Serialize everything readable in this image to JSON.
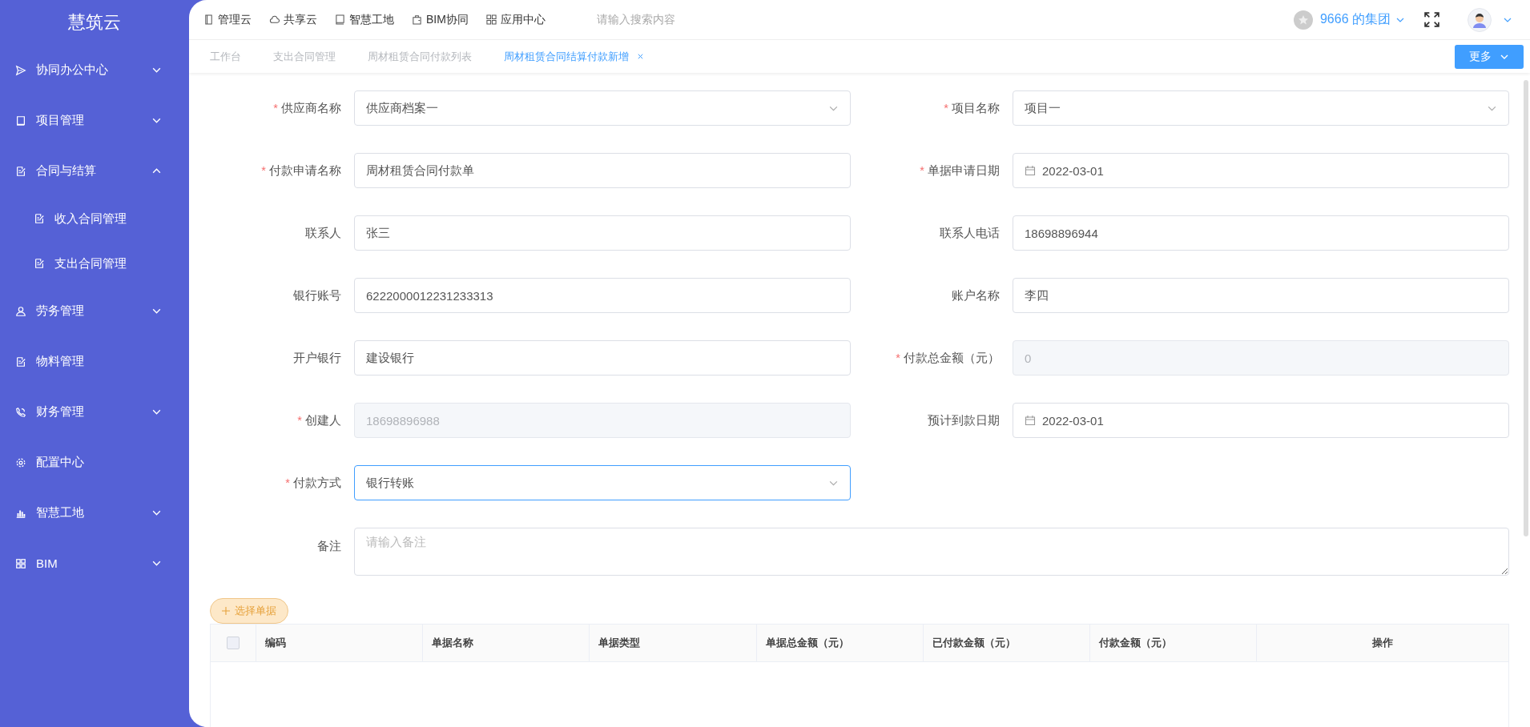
{
  "sidebar": {
    "title": "慧筑云",
    "items": [
      {
        "label": "协同办公中心",
        "expanded": false
      },
      {
        "label": "项目管理",
        "expanded": false
      },
      {
        "label": "合同与结算",
        "expanded": true,
        "children": [
          {
            "label": "收入合同管理"
          },
          {
            "label": "支出合同管理"
          }
        ]
      },
      {
        "label": "劳务管理",
        "expanded": false
      },
      {
        "label": "物料管理"
      },
      {
        "label": "财务管理",
        "expanded": false
      },
      {
        "label": "配置中心"
      },
      {
        "label": "智慧工地",
        "expanded": false
      },
      {
        "label": "BIM",
        "expanded": false
      }
    ]
  },
  "top_nav": {
    "links": [
      "管理云",
      "共享云",
      "智慧工地",
      "BIM协同",
      "应用中心"
    ],
    "search": {
      "placeholder": "请输入搜索内容"
    },
    "organization": "9666 的集团"
  },
  "tabs": [
    {
      "label": "工作台",
      "selected": false
    },
    {
      "label": "支出合同管理",
      "selected": false
    },
    {
      "label": "周材租赁合同付款列表",
      "selected": false
    },
    {
      "label": "周材租赁合同结算付款新增",
      "selected": true
    }
  ],
  "more_button": "更多",
  "form": {
    "fields": [
      {
        "label": "供应商名称",
        "required_mark": "*",
        "kind": "select",
        "value": "供应商档案一"
      },
      {
        "label": "项目名称",
        "required_mark": "*",
        "kind": "select",
        "value": "项目一"
      },
      {
        "label": "付款申请名称",
        "required_mark": "*",
        "kind": "input",
        "value": "周材租赁合同付款单"
      },
      {
        "label": "单据申请日期",
        "required_mark": "*",
        "kind": "date",
        "value": "2022-03-01"
      },
      {
        "label": "联系人",
        "kind": "input",
        "value": "张三"
      },
      {
        "label": "联系人电话",
        "kind": "input",
        "value": "18698896944"
      },
      {
        "label": "银行账号",
        "kind": "input",
        "value": "6222000012231233313"
      },
      {
        "label": "账户名称",
        "kind": "input",
        "value": "李四"
      },
      {
        "label": "开户银行",
        "kind": "input",
        "value": "建设银行"
      },
      {
        "label": "付款总金额（元）",
        "required_mark": "*",
        "kind": "disabled",
        "value": "0"
      },
      {
        "label": "创建人",
        "required_mark": "*",
        "kind": "disabled",
        "value": "18698896988"
      },
      {
        "label": "预计到款日期",
        "kind": "date",
        "value": "2022-03-01"
      },
      {
        "label": "付款方式",
        "required_mark": "*",
        "kind": "select",
        "value": "银行转账",
        "focused": true
      }
    ],
    "remark": {
      "label": "备注",
      "placeholder": "请输入备注"
    }
  },
  "select_button": "选择单据",
  "table": {
    "select_all_checked": false,
    "columns": [
      "编码",
      "单据名称",
      "单据类型",
      "单据总金额（元）",
      "已付款金额（元）",
      "付款金额（元）",
      "操作"
    ]
  }
}
